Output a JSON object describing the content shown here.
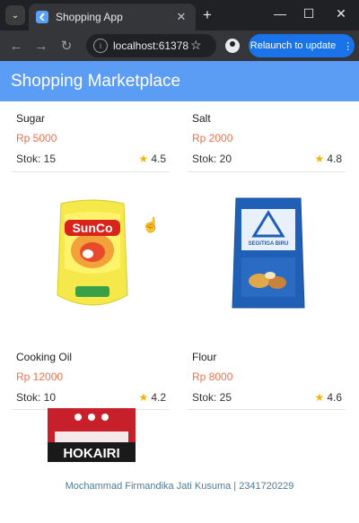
{
  "browser": {
    "tab_title": "Shopping App",
    "url": "localhost:61378",
    "relaunch_label": "Relaunch to update"
  },
  "app": {
    "title": "Shopping Marketplace",
    "footer": "Mochammad Firmandika Jati Kusuma | 2341720229"
  },
  "products": [
    {
      "name": "Sugar",
      "price": "Rp 5000",
      "stock": "Stok: 15",
      "rating": "4.5"
    },
    {
      "name": "Salt",
      "price": "Rp 2000",
      "stock": "Stok: 20",
      "rating": "4.8"
    },
    {
      "name": "Cooking Oil",
      "price": "Rp 12000",
      "stock": "Stok: 10",
      "rating": "4.2"
    },
    {
      "name": "Flour",
      "price": "Rp 8000",
      "stock": "Stok: 25",
      "rating": "4.6"
    }
  ],
  "image_labels": {
    "oil_brand": "SunCo",
    "flour_brand": "SEGITIGA BIRU",
    "rice_brand": "HOKAIRI"
  }
}
